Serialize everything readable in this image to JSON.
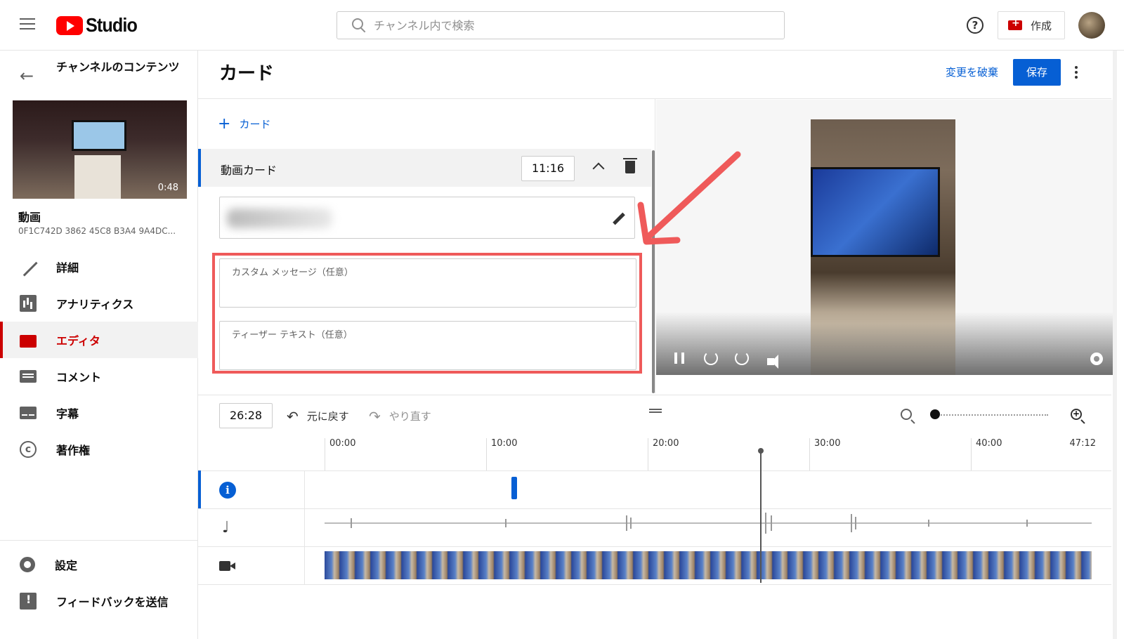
{
  "header": {
    "logo_text": "Studio",
    "search_placeholder": "チャンネル内で検索",
    "help_label": "?",
    "create_label": "作成"
  },
  "sidebar": {
    "back_title": "チャンネルのコンテンツ",
    "thumb_duration": "0:48",
    "video_label": "動画",
    "video_id": "0F1C742D 3862 45C8 B3A4 9A4DC...",
    "nav": [
      {
        "label": "詳細",
        "icon": "pencil-icon"
      },
      {
        "label": "アナリティクス",
        "icon": "analytics-icon"
      },
      {
        "label": "エディタ",
        "icon": "editor-icon",
        "active": true
      },
      {
        "label": "コメント",
        "icon": "comment-icon"
      },
      {
        "label": "字幕",
        "icon": "subtitles-icon"
      },
      {
        "label": "著作権",
        "icon": "copyright-icon"
      }
    ],
    "footer": [
      {
        "label": "設定",
        "icon": "gear-icon"
      },
      {
        "label": "フィードバックを送信",
        "icon": "feedback-icon"
      }
    ]
  },
  "main": {
    "title": "カード",
    "discard_label": "変更を破棄",
    "save_label": "保存",
    "add_card_label": "カード",
    "card": {
      "type_label": "動画カード",
      "time": "11:16"
    },
    "custom_message_label": "カスタム メッセージ（任意）",
    "teaser_label": "ティーザー テキスト（任意）"
  },
  "timeline": {
    "current_time": "26:28",
    "undo_label": "元に戻す",
    "redo_label": "やり直す",
    "ticks": [
      "00:00",
      "10:00",
      "20:00",
      "30:00",
      "40:00"
    ],
    "end_time": "47:12",
    "zoom_level": 0
  },
  "colors": {
    "accent": "#065fd4",
    "brand_red": "#cc0000",
    "highlight_red": "#ef5a5a"
  }
}
